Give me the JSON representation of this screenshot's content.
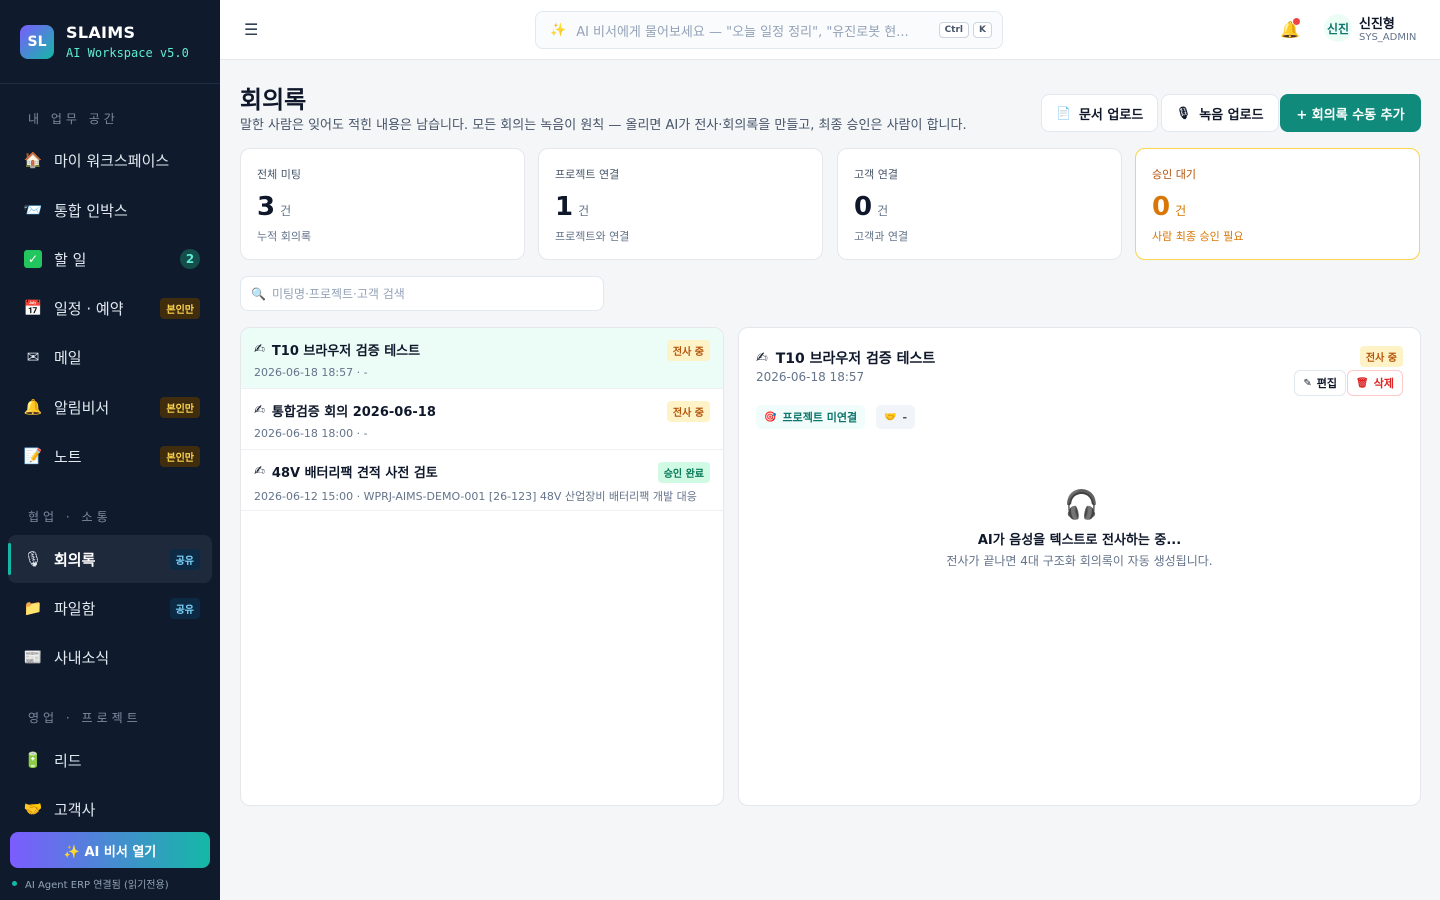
{
  "app": {
    "logo": "SL",
    "name": "SLAIMS",
    "version": "AI Workspace v5.0"
  },
  "sidebar": {
    "sections": [
      {
        "label": "내 업무 공간"
      },
      {
        "label": "협업 · 소통"
      },
      {
        "label": "영업 · 프로젝트"
      }
    ],
    "items": [
      {
        "label": "마이 워크스페이스",
        "icon": "house-icon"
      },
      {
        "label": "통합 인박스",
        "icon": "inbox-icon"
      },
      {
        "label": "할 일",
        "icon": "checkbox-icon",
        "count": "2"
      },
      {
        "label": "일정 · 예약",
        "icon": "calendar-icon",
        "badge": "본인만"
      },
      {
        "label": "메일",
        "icon": "envelope-icon"
      },
      {
        "label": "알림비서",
        "icon": "bell-icon",
        "badge": "본인만"
      },
      {
        "label": "노트",
        "icon": "memo-icon",
        "badge": "본인만"
      },
      {
        "label": "회의록",
        "icon": "microphone-icon",
        "badge": "공유"
      },
      {
        "label": "파일함",
        "icon": "folder-icon",
        "badge": "공유"
      },
      {
        "label": "사내소식",
        "icon": "newspaper-icon"
      },
      {
        "label": "리드",
        "icon": "battery-icon"
      },
      {
        "label": "고객사",
        "icon": "handshake-icon"
      }
    ],
    "ai_button": "✨ AI 비서 열기",
    "connection": "AI Agent ERP 연결됨 (읽기전용)"
  },
  "topbar": {
    "search_placeholder": "AI 비서에게 물어보세요 — \"오늘 일정 정리\", \"유진로봇 현...",
    "kbd_ctrl": "Ctrl",
    "kbd_k": "K",
    "user_avatar": "신진",
    "user_name": "신진형",
    "user_role": "SYS_ADMIN"
  },
  "page": {
    "title": "회의록",
    "description": "말한 사람은 잊어도 적힌 내용은 남습니다. 모든 회의는 녹음이 원칙 — 올리면 AI가 전사·회의록을 만들고, 최종 승인은 사람이 합니다.",
    "btn_doc": "문서 업로드",
    "btn_rec": "녹음 업로드",
    "btn_add": "+ 회의록 수동 추가"
  },
  "stats": [
    {
      "label": "전체 미팅",
      "value": "3",
      "unit": "건",
      "sub": "누적 회의록"
    },
    {
      "label": "프로젝트 연결",
      "value": "1",
      "unit": "건",
      "sub": "프로젝트와 연결"
    },
    {
      "label": "고객 연결",
      "value": "0",
      "unit": "건",
      "sub": "고객과 연결"
    },
    {
      "label": "승인 대기",
      "value": "0",
      "unit": "건",
      "sub": "사람 최종 승인 필요"
    }
  ],
  "list_search_placeholder": "미팅명·프로젝트·고객 검색",
  "meetings": [
    {
      "title": "T10 브라우저 검증 테스트",
      "meta": "2026-06-18 18:57 · -",
      "status": "전사 중"
    },
    {
      "title": "통합검증 회의 2026-06-18",
      "meta": "2026-06-18 18:00 · -",
      "status": "전사 중"
    },
    {
      "title": "48V 배터리팩 견적 사전 검토",
      "meta": "2026-06-12 15:00 · WPRJ-AIMS-DEMO-001 [26-123] 48V 산업장비 배터리팩 개발 대응",
      "status": "승인 완료"
    }
  ],
  "detail": {
    "title": "T10 브라우저 검증 테스트",
    "date": "2026-06-18 18:57",
    "status": "전사 중",
    "edit": "편집",
    "delete": "삭제",
    "chip_project": "프로젝트 미연결",
    "chip_customer": "-",
    "empty_title": "AI가 음성을 텍스트로 전사하는 중...",
    "empty_sub": "전사가 끝나면 4대 구조화 회의록이 자동 생성됩니다."
  },
  "colors": {
    "sidebar_bg": "#0f1b2d",
    "accent": "#0f8a7b",
    "warning": "#d97706"
  }
}
